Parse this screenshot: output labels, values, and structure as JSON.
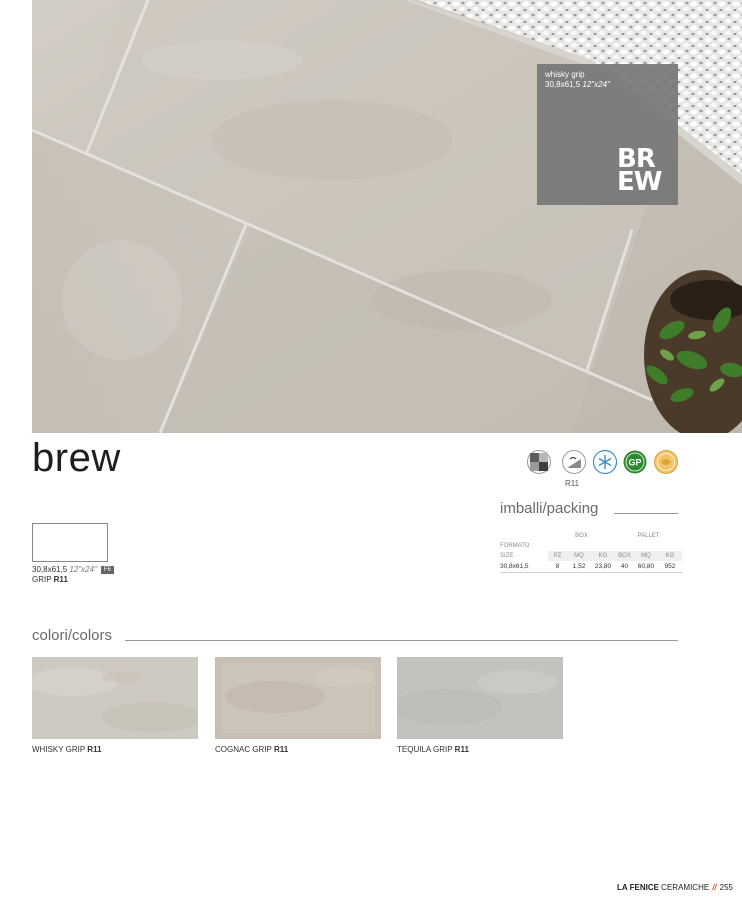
{
  "product": {
    "name": "brew",
    "badge_name": "whisky grip",
    "badge_size": "30,8x61,5",
    "badge_size_inch": "12\"x24\"",
    "logo_line1": "BR",
    "logo_line2": "EW"
  },
  "features": {
    "icons": [
      "mosaic-icon",
      "slip-resistance-icon",
      "frost-resistant-icon",
      "gp-green-icon",
      "eco-certified-icon"
    ],
    "slip_label": "R11",
    "gp_text": "GP",
    "colors": {
      "green": "#2e8a2e",
      "orange": "#e0a436",
      "blue": "#3d8fc7"
    }
  },
  "packing": {
    "title": "imballi/packing",
    "col_formato": "FORMATO",
    "col_size": "SIZE",
    "group_box": "BOX",
    "group_pallet": "PALLET",
    "sub": [
      "PZ",
      "MQ",
      "KG",
      "BOX",
      "MQ",
      "KG"
    ],
    "row": {
      "size": "30,8x61,5",
      "values": [
        "8",
        "1,52",
        "23,80",
        "40",
        "60,80",
        "952"
      ]
    }
  },
  "format": {
    "size": "30,8x61,5",
    "size_inch": "12\"x24\"",
    "tag": "F6",
    "grip": "GRIP",
    "grip_rating": "R11"
  },
  "colors": {
    "title": "colori/colors",
    "items": [
      {
        "name": "WHISKY GRIP",
        "rating": "R11",
        "tone": "#cfcac1"
      },
      {
        "name": "COGNAC GRIP",
        "rating": "R11",
        "tone": "#c7bfb4"
      },
      {
        "name": "TEQUILA GRIP",
        "rating": "R11",
        "tone": "#c4c2bf"
      }
    ]
  },
  "footer": {
    "brand": "LA FENICE",
    "brand_sub": "CERAMICHE",
    "separator": "//",
    "page": "255"
  }
}
